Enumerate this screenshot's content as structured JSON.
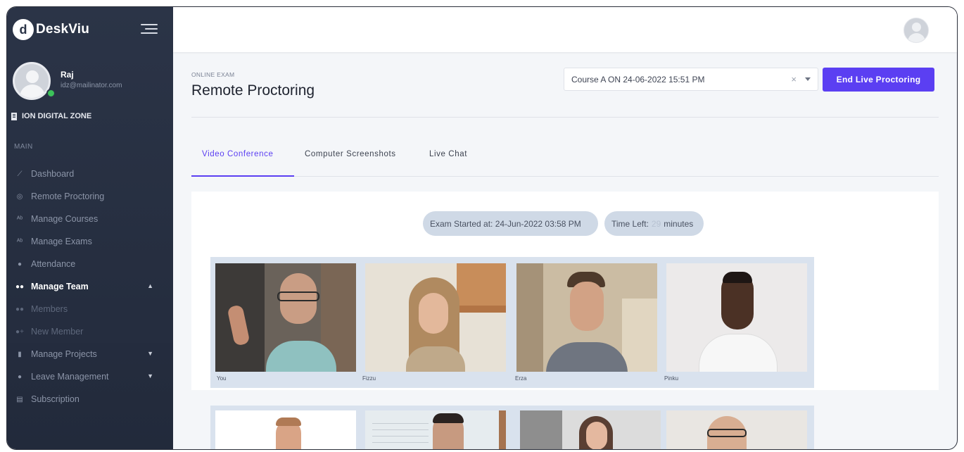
{
  "brand": {
    "logo_glyph": "d",
    "name": "DeskViu"
  },
  "profile": {
    "name": "Raj",
    "email": "idz@mailinator.com"
  },
  "organization": "ION DIGITAL ZONE",
  "sidebar": {
    "section_label": "MAIN",
    "items": [
      {
        "label": "Dashboard",
        "icon": "chart-line-icon"
      },
      {
        "label": "Remote Proctoring",
        "icon": "target-icon"
      },
      {
        "label": "Manage Courses",
        "icon": "abc-icon"
      },
      {
        "label": "Manage Exams",
        "icon": "abc-icon"
      },
      {
        "label": "Attendance",
        "icon": "user-check-icon"
      },
      {
        "label": "Manage Team",
        "icon": "users-icon",
        "expanded": true
      },
      {
        "label": "Members",
        "icon": "users-icon"
      },
      {
        "label": "New Member",
        "icon": "user-plus-icon"
      },
      {
        "label": "Manage Projects",
        "icon": "bar-chart-icon"
      },
      {
        "label": "Leave Management",
        "icon": "globe-icon"
      },
      {
        "label": "Subscription",
        "icon": "document-icon"
      }
    ]
  },
  "header": {
    "breadcrumb": "ONLINE EXAM",
    "title": "Remote Proctoring"
  },
  "course_select": {
    "value": "Course A ON 24-06-2022 15:51 PM"
  },
  "end_button": "End Live Proctoring",
  "tabs": [
    {
      "label": "Video Conference",
      "active": true
    },
    {
      "label": "Computer Screenshots",
      "active": false
    },
    {
      "label": "Live Chat",
      "active": false
    }
  ],
  "exam": {
    "started_label": "Exam Started at: 24-Jun-2022 03:58 PM",
    "time_left_prefix": "Time Left:",
    "time_left_value": "29",
    "time_left_suffix": "minutes"
  },
  "participants": [
    "You",
    "Fizzu",
    "Erza",
    "Pinku"
  ],
  "colors": {
    "accent": "#5b3ff2",
    "sidebar": "#2b3447",
    "online": "#3cc25a"
  }
}
